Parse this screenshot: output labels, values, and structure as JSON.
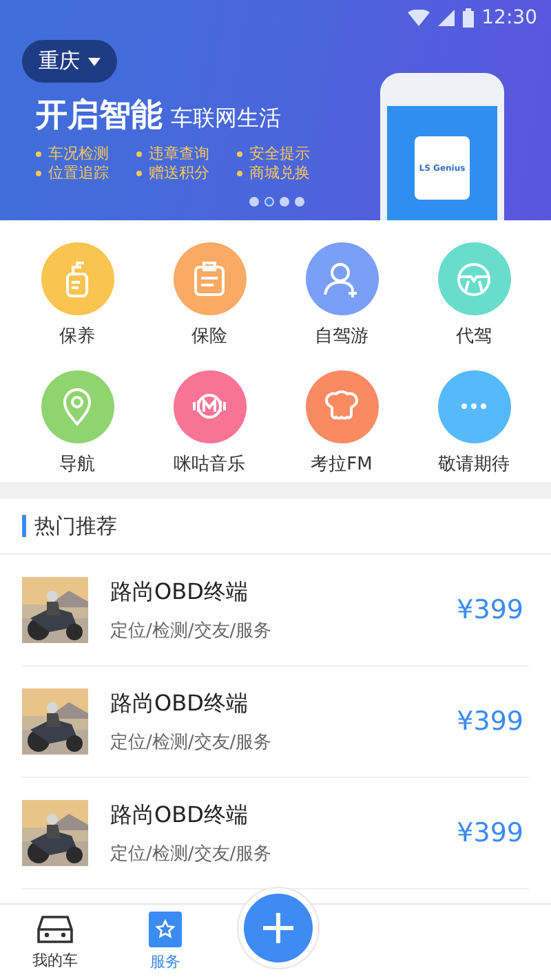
{
  "status_bar": {
    "time": "12:30"
  },
  "banner": {
    "city": "重庆",
    "headline": "开启智能",
    "subline": "车联网生活",
    "features": [
      "车况检测",
      "违章查询",
      "安全提示",
      "位置追踪",
      "赠送积分",
      "商城兑换"
    ],
    "device_label": "LS Genius",
    "dots": [
      {
        "selected": false
      },
      {
        "selected": true
      },
      {
        "selected": false
      },
      {
        "selected": false
      }
    ]
  },
  "services": [
    {
      "label": "保养",
      "kind": "bottle",
      "color": "#f9c44f"
    },
    {
      "label": "保险",
      "kind": "ins",
      "color": "#f9aa64"
    },
    {
      "label": "自驾游",
      "kind": "person",
      "color": "#7a9ff7"
    },
    {
      "label": "代驾",
      "kind": "wheel",
      "color": "#68ddcc"
    },
    {
      "label": "导航",
      "kind": "pin",
      "color": "#8fd46f"
    },
    {
      "label": "咪咕音乐",
      "kind": "music",
      "color": "#f77495"
    },
    {
      "label": "考拉FM",
      "kind": "koala",
      "color": "#f98a62"
    },
    {
      "label": "敬请期待",
      "kind": "more",
      "color": "#55b9fb"
    }
  ],
  "hot": {
    "title": "热门推荐",
    "items": [
      {
        "name": "路尚OBD终端",
        "tags": "定位/检测/交友/服务",
        "price": "¥399"
      },
      {
        "name": "路尚OBD终端",
        "tags": "定位/检测/交友/服务",
        "price": "¥399"
      },
      {
        "name": "路尚OBD终端",
        "tags": "定位/检测/交友/服务",
        "price": "¥399"
      }
    ]
  },
  "tab_bar": {
    "tabs": [
      {
        "label": "我的车",
        "kind": "car",
        "selected": false
      },
      {
        "label": "服务",
        "kind": "ticket",
        "selected": true
      }
    ]
  }
}
